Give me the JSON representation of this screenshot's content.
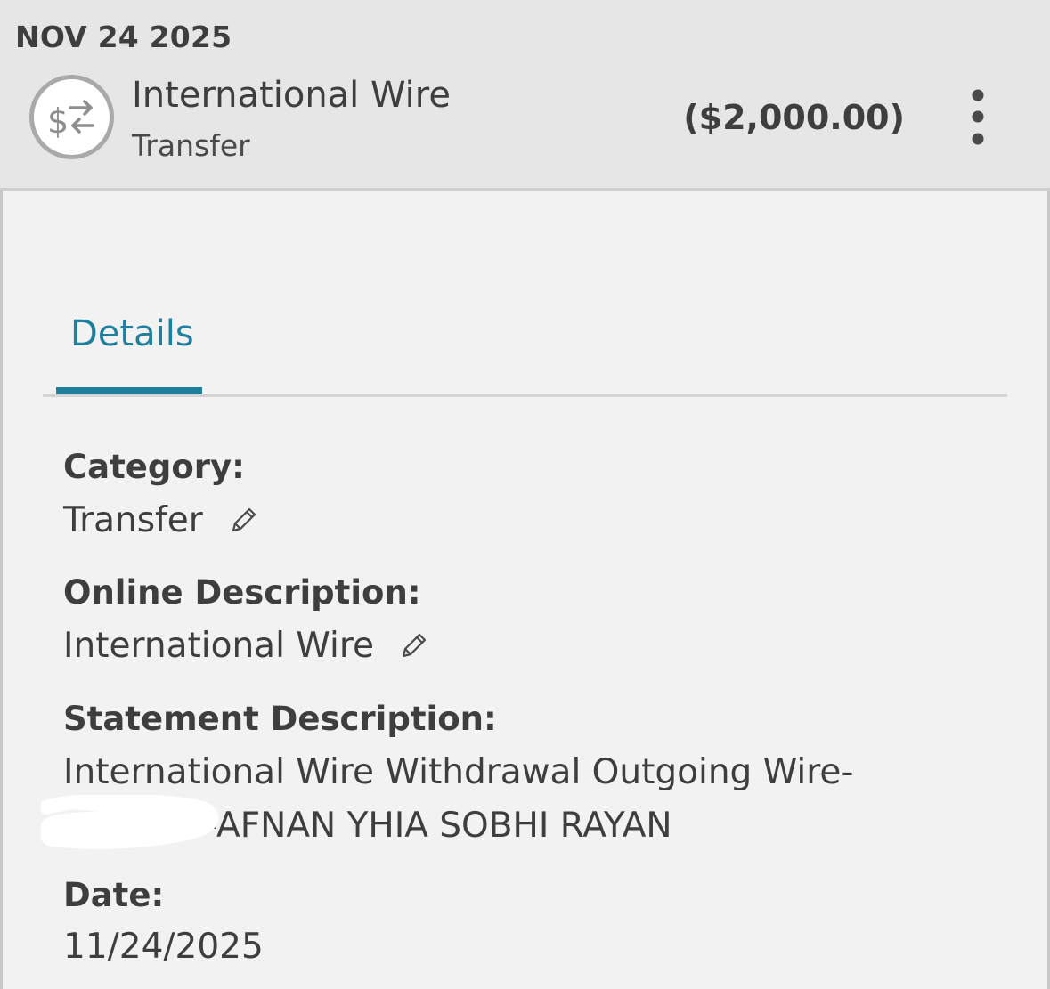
{
  "header": {
    "date": "NOV 24 2025",
    "title": "International Wire",
    "subtitle": "Transfer",
    "amount": "($2,000.00)",
    "icon": "transfer-dollar-icon",
    "more_icon": "more-vertical-icon"
  },
  "tabs": [
    {
      "label": "Details",
      "active": true
    }
  ],
  "details": {
    "category": {
      "label": "Category:",
      "value": "Transfer",
      "editable": true
    },
    "online_description": {
      "label": "Online Description:",
      "value": "International Wire",
      "editable": true
    },
    "statement_description": {
      "label": "Statement Description:",
      "line1": "International Wire Withdrawal Outgoing Wire-",
      "line2": "0-AFNAN YHIA SOBHI RAYAN",
      "redacted": true
    },
    "date": {
      "label": "Date:",
      "value": "11/24/2025"
    }
  },
  "colors": {
    "accent": "#1f7f9e",
    "header_bg": "#e6e6e6",
    "page_bg": "#f2f2f2",
    "text": "#3e3e3e"
  }
}
